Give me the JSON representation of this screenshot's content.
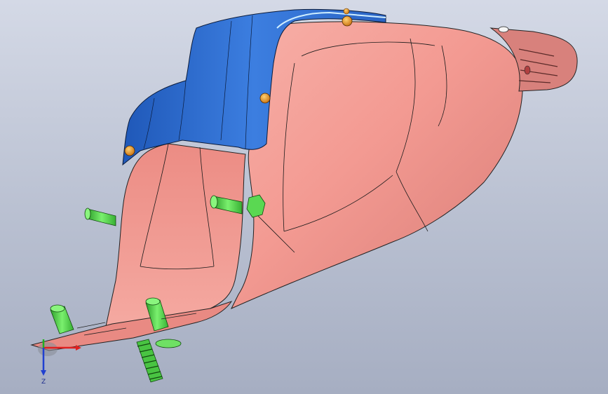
{
  "viewport": {
    "background_top": "#d4d9e6",
    "background_bottom": "#a6aec2"
  },
  "model": {
    "housing_color": "#f0908a",
    "cover_color": "#2f6bd0",
    "fastener_color": "#4fd84a",
    "bolt_head_color": "#f0a020"
  },
  "triad": {
    "z_label": "Z",
    "x_axis_color": "#e02020",
    "y_axis_color": "#20b020",
    "z_axis_color": "#2040d0"
  }
}
